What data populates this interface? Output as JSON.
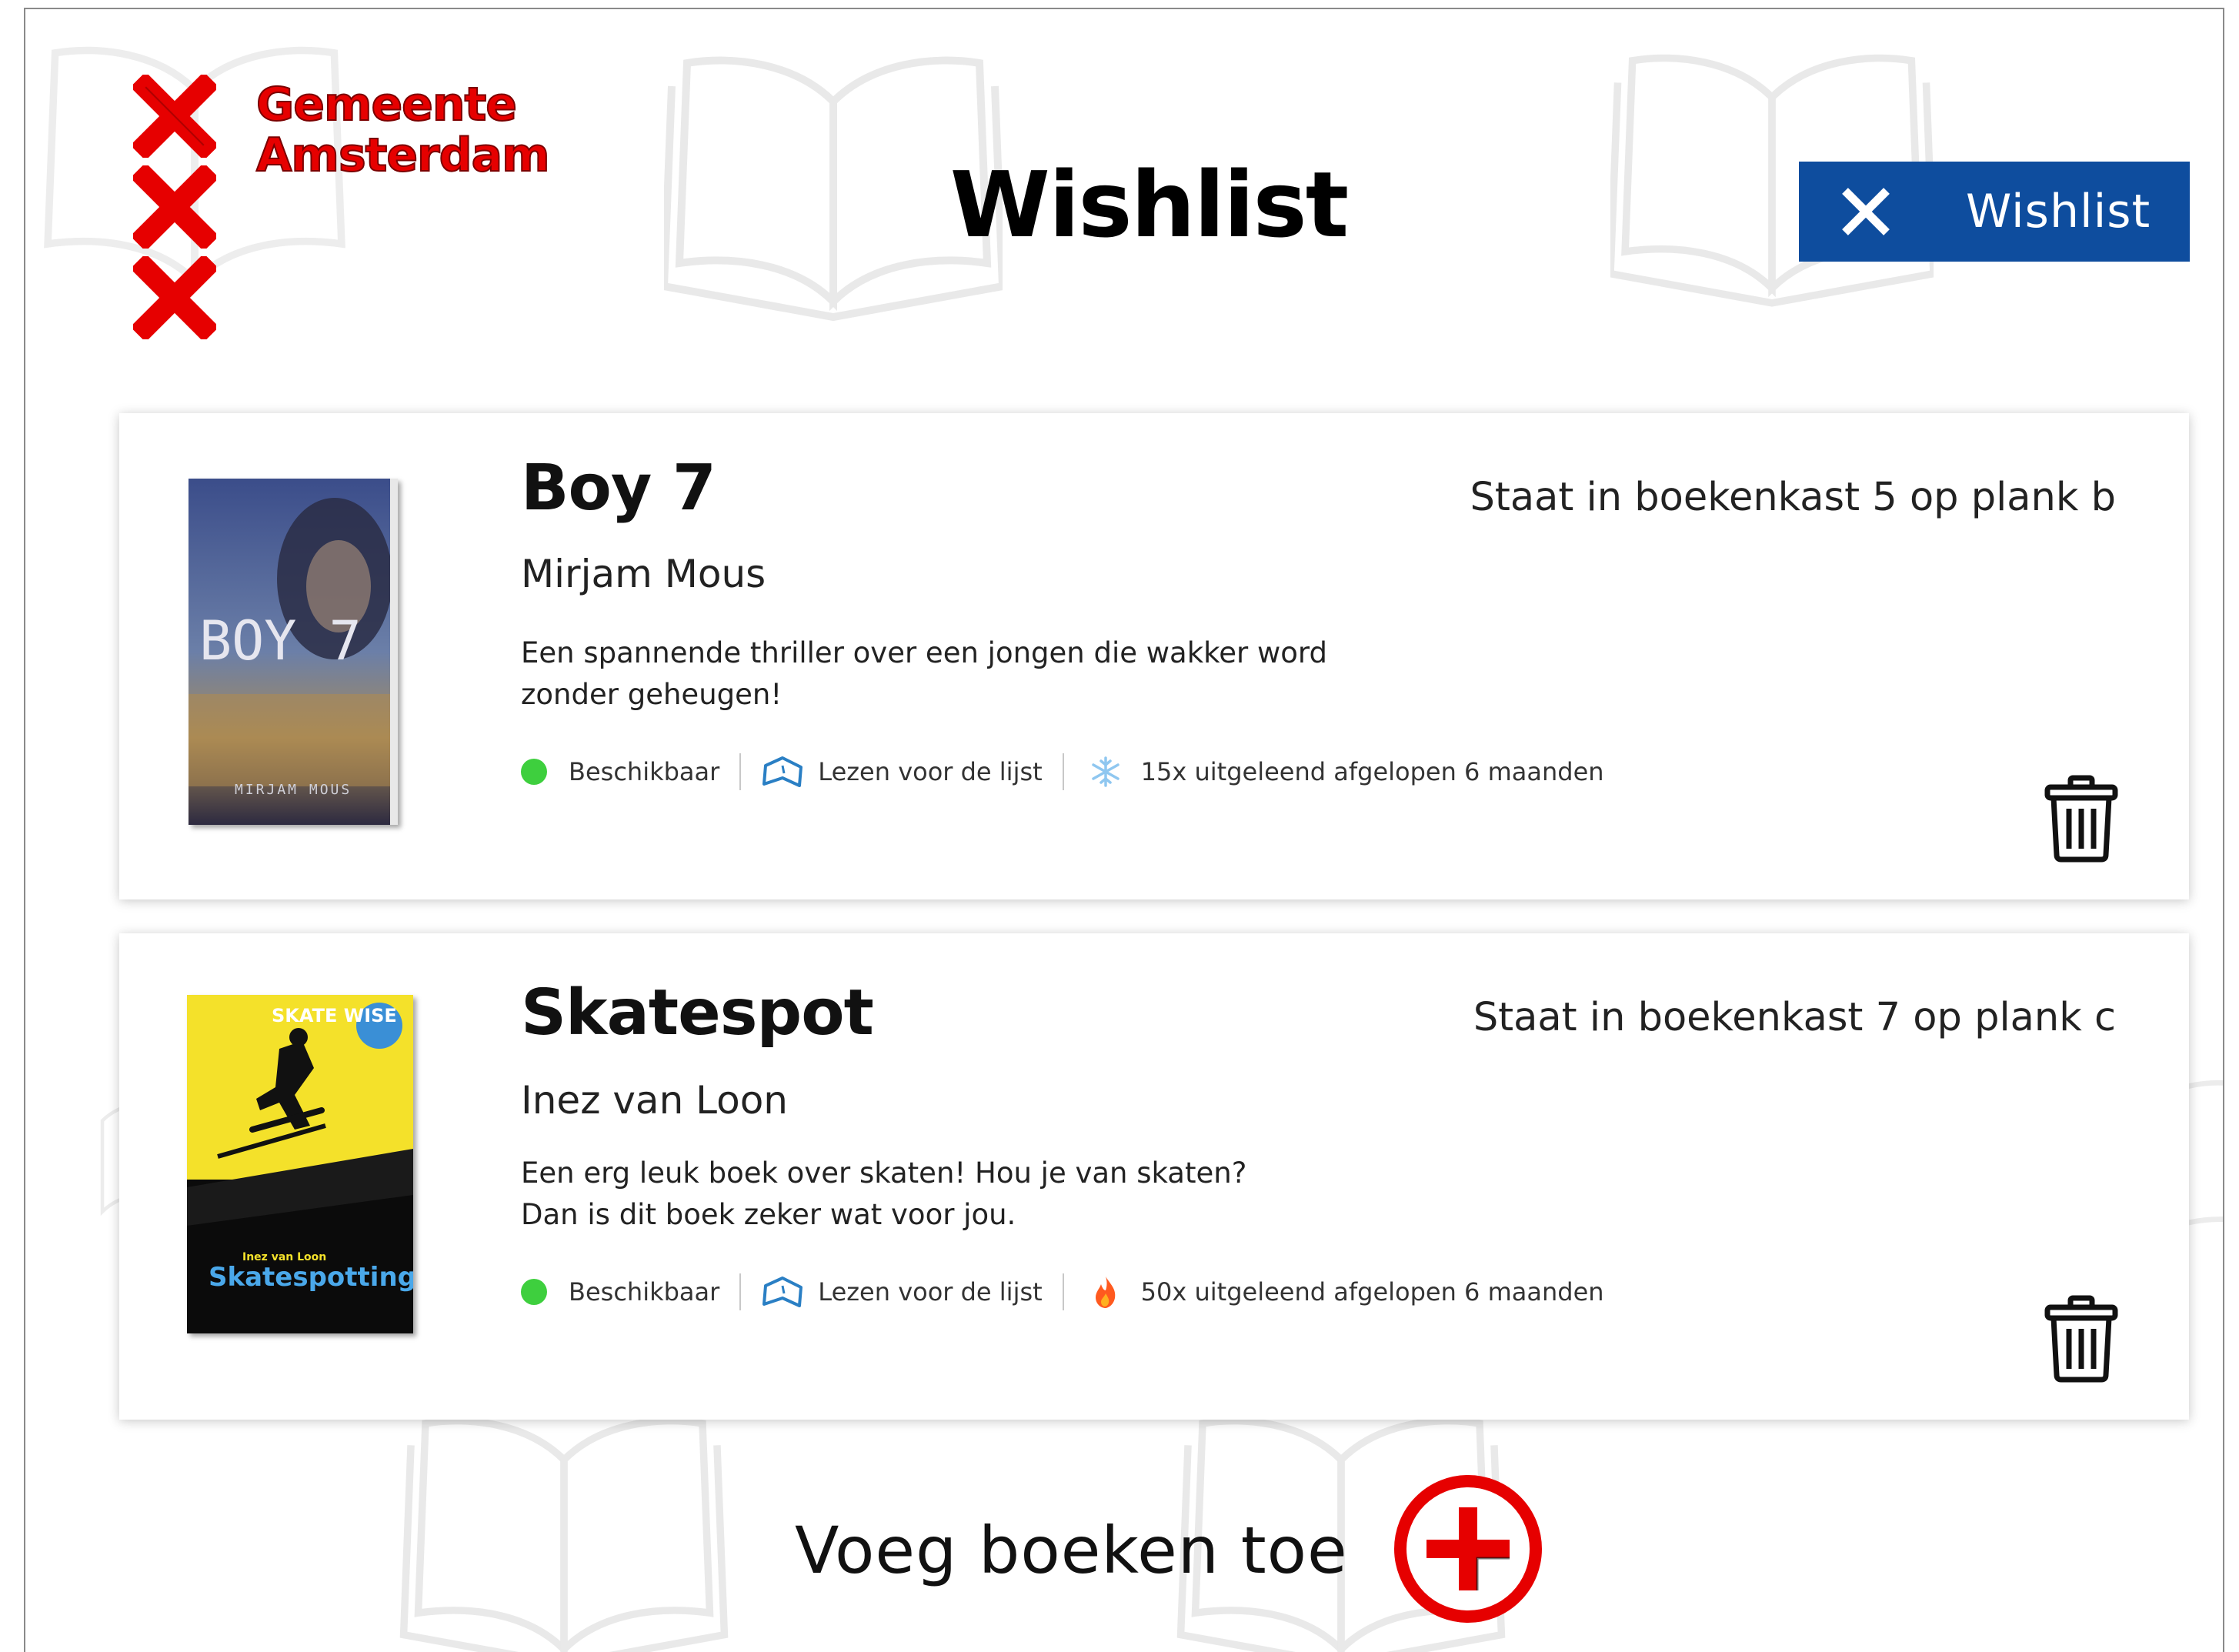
{
  "header": {
    "logo_text_line1": "Gemeente",
    "logo_text_line2": "Amsterdam",
    "title": "Wishlist",
    "wishlist_button_label": "Wishlist"
  },
  "books": [
    {
      "title": "Boy 7",
      "author": "Mirjam Mous",
      "description": "Een spannende thriller over een jongen die wakker word zonder geheugen!",
      "location": "Staat in boekenkast 5 op plank b",
      "availability": "Beschikbaar",
      "reading_list": "Lezen voor de lijst",
      "loans": "15x uitgeleend afgelopen 6 maanden",
      "loans_icon": "snowflake-icon",
      "cover": {
        "title": "BOY 7",
        "author": "MIRJAM MOUS"
      }
    },
    {
      "title": "Skatespot",
      "author": "Inez van Loon",
      "description_line1": "Een erg leuk boek over skaten! Hou je van skaten?",
      "description_line2": "Dan is dit boek zeker wat voor jou.",
      "location": "Staat in boekenkast 7 op plank c",
      "availability": "Beschikbaar",
      "reading_list": "Lezen voor de lijst",
      "loans": "50x uitgeleend afgelopen 6 maanden",
      "loans_icon": "flame-icon",
      "cover": {
        "series": "SKATE WISE",
        "author": "Inez van Loon",
        "title": "Skatespotting"
      }
    }
  ],
  "footer": {
    "add_books_label": "Voeg boeken toe"
  },
  "colors": {
    "brand_red": "#e60000",
    "button_blue": "#0e4d9e",
    "available_green": "#3ecf3e",
    "reading_list_blue": "#2a7fc4",
    "flame_orange": "#ff5a1f",
    "snowflake_blue": "#8fc7f0"
  }
}
